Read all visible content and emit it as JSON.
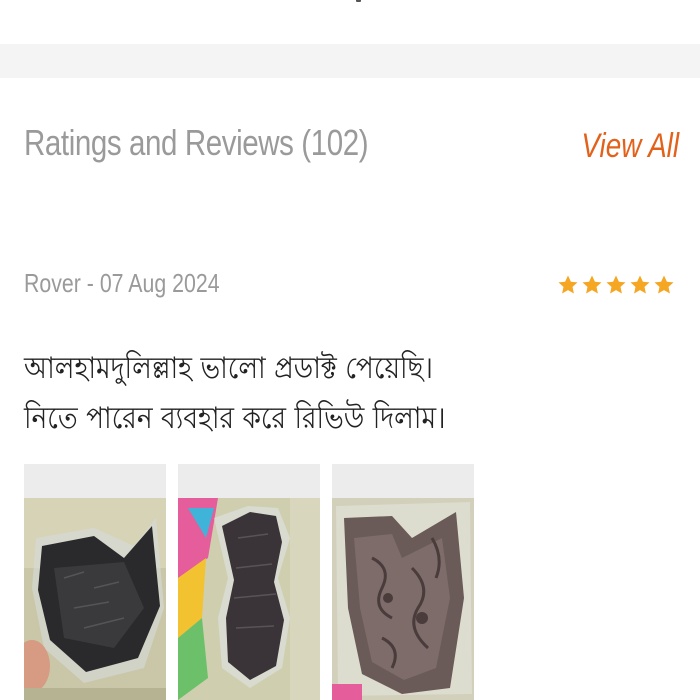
{
  "section": {
    "title": "Ratings and Reviews (102)",
    "view_all_label": "View All"
  },
  "review": {
    "meta": "Rover - 07 Aug 2024",
    "rating": 5,
    "rating_max": 5,
    "text_lines": [
      "আলহামদুলিল্লাহ ভালো প্রডাক্ট পেয়েছি।",
      "নিতে পারেন ব্যবহার করে রিভিউ দিলাম।"
    ],
    "photos": [
      "review-photo-1",
      "review-photo-2",
      "review-photo-3"
    ]
  },
  "colors": {
    "accent": "#e2621b",
    "star": "#f5a623",
    "muted_text": "#9a9a9a",
    "body_text": "#222222",
    "separator": "#f4f4f4"
  }
}
